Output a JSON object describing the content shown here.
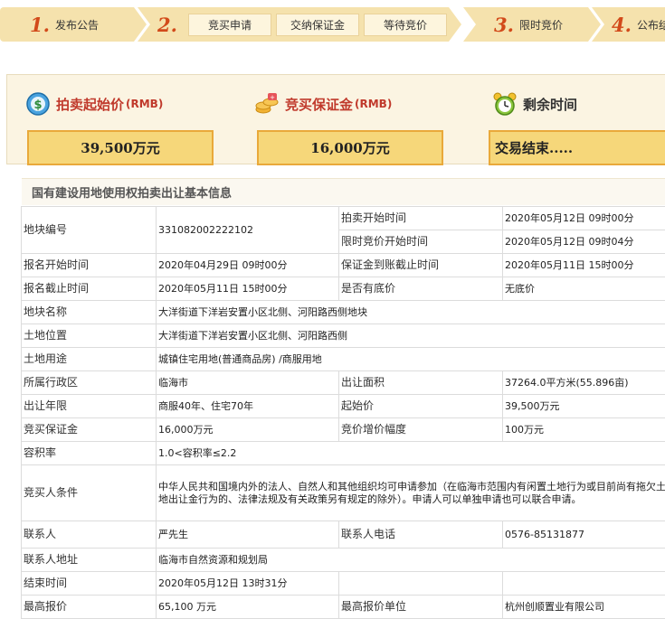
{
  "steps": {
    "step1": {
      "num": "1.",
      "label": "发布公告"
    },
    "step2": {
      "num": "2.",
      "sub": [
        "竞买申请",
        "交纳保证金",
        "等待竞价"
      ]
    },
    "step3": {
      "num": "3.",
      "label": "限时竞价"
    },
    "step4": {
      "num": "4.",
      "label": "公布结"
    }
  },
  "metrics": {
    "start_price": {
      "title": "拍卖起始价",
      "unit": "(RMB)",
      "value": "39,500万元",
      "icon": "money-bag-icon"
    },
    "deposit": {
      "title": "竞买保证金",
      "unit": "(RMB)",
      "value": "16,000万元",
      "icon": "coins-icon"
    },
    "remaining": {
      "title": "剩余时间",
      "value": "交易结束.....",
      "icon": "alarm-clock-icon"
    }
  },
  "section": {
    "title": "国有建设用地使用权拍卖出让基本信息"
  },
  "table": {
    "plot_no": {
      "label": "地块编号",
      "value": "331082002222102"
    },
    "auction_start": {
      "label": "拍卖开始时间",
      "value": "2020年05月12日 09时00分"
    },
    "timed_start": {
      "label": "限时竞价开始时间",
      "value": "2020年05月12日 09时04分"
    },
    "reg_start": {
      "label": "报名开始时间",
      "value": "2020年04月29日 09时00分"
    },
    "deposit_deadline": {
      "label": "保证金到账截止时间",
      "value": "2020年05月11日 15时00分"
    },
    "reg_end": {
      "label": "报名截止时间",
      "value": "2020年05月11日 15时00分"
    },
    "reserve": {
      "label": "是否有底价",
      "value": "无底价"
    },
    "plot_name": {
      "label": "地块名称",
      "value": "大洋街道下洋岩安置小区北侧、河阳路西侧地块"
    },
    "location": {
      "label": "土地位置",
      "value": "大洋街道下洋岩安置小区北侧、河阳路西侧"
    },
    "usage": {
      "label": "土地用途",
      "value": "城镇住宅用地(普通商品房) /商服用地"
    },
    "district": {
      "label": "所属行政区",
      "value": "临海市"
    },
    "area": {
      "label": "出让面积",
      "value": "37264.0平方米(55.896亩)"
    },
    "term": {
      "label": "出让年限",
      "value": "商服40年、住宅70年"
    },
    "start_price": {
      "label": "起始价",
      "value": "39,500万元"
    },
    "deposit": {
      "label": "竞买保证金",
      "value": "16,000万元"
    },
    "increment": {
      "label": "竞价增价幅度",
      "value": "100万元"
    },
    "far": {
      "label": "容积率",
      "value": "1.0<容积率≤2.2"
    },
    "conditions": {
      "label": "竞买人条件",
      "value": "中华人民共和国境内外的法人、自然人和其他组织均可申请参加（在临海市范围内有闲置土地行为或目前尚有拖欠土地出让金行为的、法律法规及有关政策另有规定的除外）。申请人可以单独申请也可以联合申请。"
    },
    "contact": {
      "label": "联系人",
      "value": "严先生"
    },
    "phone": {
      "label": "联系人电话",
      "value": "0576-85131877"
    },
    "address": {
      "label": "联系人地址",
      "value": "临海市自然资源和规划局"
    },
    "end_time": {
      "label": "结束时间",
      "value": "2020年05月12日 13时31分"
    },
    "top_bid": {
      "label": "最高报价",
      "value": "65,100 万元"
    },
    "top_bidder": {
      "label": "最高报价单位",
      "value": "杭州创顺置业有限公司"
    }
  }
}
